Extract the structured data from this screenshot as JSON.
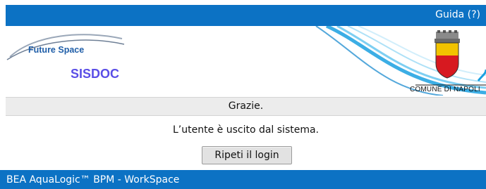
{
  "header": {
    "help_link": "Guida (?)"
  },
  "banner": {
    "brand_name": "Future Space",
    "product_name": "SISDOC",
    "municipality": "COMUNE DI NAPOLI"
  },
  "status": {
    "title": "Grazie."
  },
  "main": {
    "message": "L’utente è uscito dal sistema.",
    "relogin_button": "Ripeti il login"
  },
  "footer": {
    "product": "BEA AquaLogic™ BPM - WorkSpace"
  },
  "colors": {
    "bar_blue": "#0c72c4",
    "wave_blue": "#1aa0e0",
    "sisdoc_purple": "#5a4ee6",
    "status_grey": "#ececec"
  },
  "icons": [
    "future-space-swoosh-logo",
    "napoli-coat-of-arms",
    "decorative-wave"
  ]
}
